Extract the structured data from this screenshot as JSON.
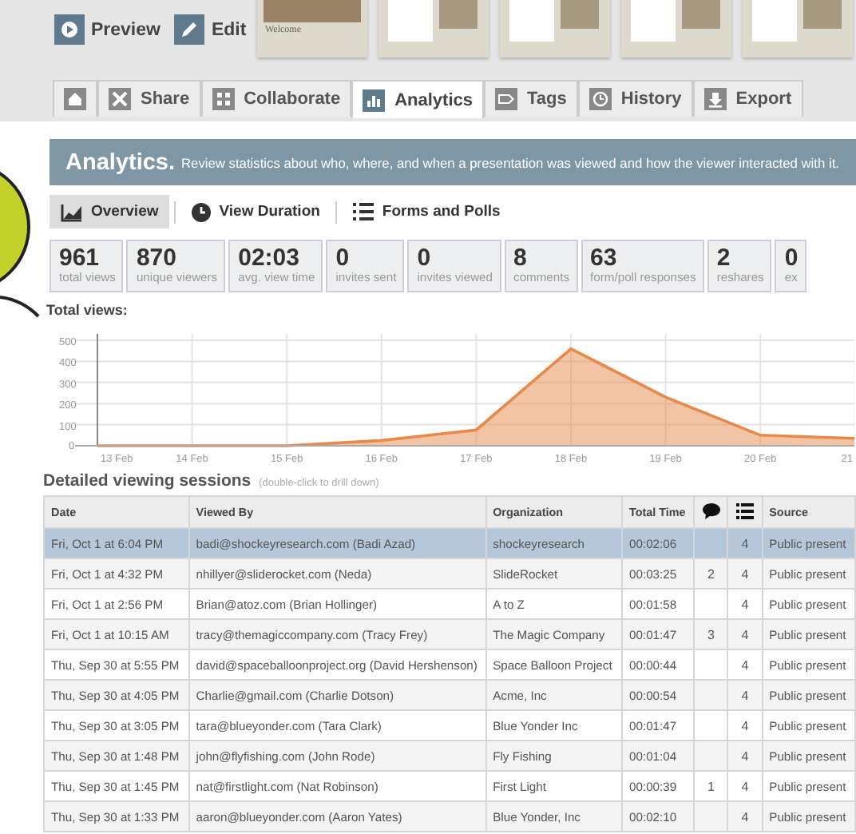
{
  "toolbar": {
    "actions": [
      {
        "kind": "preview",
        "label": "Preview"
      },
      {
        "kind": "edit",
        "label": "Edit"
      }
    ],
    "thumbnails": [
      {
        "kind": "title",
        "caption": "Welcome"
      },
      {
        "kind": "page"
      },
      {
        "kind": "page"
      },
      {
        "kind": "page"
      },
      {
        "kind": "page"
      }
    ]
  },
  "tabs": [
    {
      "kind": "home",
      "selected": false
    },
    {
      "kind": "share",
      "label": "Share",
      "selected": false
    },
    {
      "kind": "collaborate",
      "label": "Collaborate",
      "selected": false
    },
    {
      "kind": "analytics",
      "label": "Analytics",
      "selected": true
    },
    {
      "kind": "tags",
      "label": "Tags",
      "selected": false
    },
    {
      "kind": "history",
      "label": "History",
      "selected": false
    },
    {
      "kind": "export",
      "label": "Export",
      "selected": false
    }
  ],
  "banner": {
    "title": "Analytics.",
    "text": "Review statistics about who, where, and when a presentation was viewed and how the viewer interacted with it."
  },
  "subtabs": [
    {
      "kind": "overview",
      "label": "Overview",
      "selected": true
    },
    {
      "kind": "duration",
      "label": "View Duration",
      "selected": false
    },
    {
      "kind": "forms",
      "label": "Forms and Polls",
      "selected": false
    }
  ],
  "stats": [
    {
      "value": "961",
      "label": "total views"
    },
    {
      "value": "870",
      "label": "unique viewers"
    },
    {
      "value": "02:03",
      "label": "avg. view time"
    },
    {
      "value": "0",
      "label": "invites sent"
    },
    {
      "value": "0",
      "label": "invites viewed"
    },
    {
      "value": "8",
      "label": "comments"
    },
    {
      "value": "63",
      "label": "form/poll responses"
    },
    {
      "value": "2",
      "label": "reshares"
    },
    {
      "value": "0",
      "label": "ex"
    }
  ],
  "total_views": {
    "title": "Total views:",
    "chart_data": {
      "type": "area",
      "categories": [
        "13 Feb",
        "14 Feb",
        "15 Feb",
        "16 Feb",
        "17 Feb",
        "18 Feb",
        "19 Feb",
        "20 Feb",
        "21"
      ],
      "grid": true,
      "series": [
        {
          "color": "#e8894a",
          "values": [
            0,
            0,
            0,
            25,
            75,
            460,
            230,
            50,
            35
          ]
        }
      ],
      "ylim": [
        0,
        500
      ],
      "yticks": [
        0,
        100,
        200,
        300,
        400,
        500
      ]
    }
  },
  "sessions": {
    "title": "Detailed viewing sessions",
    "hint": "(double-click to drill down)",
    "columns": [
      {
        "kind": "text",
        "label": "Date"
      },
      {
        "kind": "text",
        "label": "Viewed By"
      },
      {
        "kind": "text",
        "label": "Organization"
      },
      {
        "kind": "text",
        "label": "Total Time"
      },
      {
        "kind": "comment"
      },
      {
        "kind": "list"
      },
      {
        "kind": "text",
        "label": "Source"
      }
    ],
    "rows": [
      {
        "selected": true,
        "cells": [
          "Fri, Oct 1 at 6:04 PM",
          "badi@shockeyresearch.com (Badi Azad)",
          "shockeyresearch",
          "00:02:06",
          "",
          "4",
          "Public present"
        ]
      },
      {
        "selected": false,
        "cells": [
          "Fri, Oct 1 at 4:32 PM",
          "nhillyer@sliderocket.com (Neda)",
          "SlideRocket",
          "00:03:25",
          "2",
          "4",
          "Public present"
        ]
      },
      {
        "selected": false,
        "cells": [
          "Fri, Oct 1 at 2:56 PM",
          "Brian@atoz.com (Brian Hollinger)",
          "A to Z",
          "00:01:58",
          "",
          "4",
          "Public present"
        ]
      },
      {
        "selected": false,
        "cells": [
          "Fri, Oct 1 at 10:15 AM",
          "tracy@themagiccompany.com (Tracy Frey)",
          "The Magic Company",
          "00:01:47",
          "3",
          "4",
          "Public present"
        ]
      },
      {
        "selected": false,
        "cells": [
          "Thu, Sep 30 at 5:55 PM",
          "david@spaceballoonproject.org (David Hershenson)",
          "Space Balloon Project",
          "00:00:44",
          "",
          "4",
          "Public present"
        ]
      },
      {
        "selected": false,
        "cells": [
          "Thu, Sep 30 at 4:05 PM",
          "Charlie@gmail.com (Charlie Dotson)",
          "Acme, Inc",
          "00:00:54",
          "",
          "4",
          "Public present"
        ]
      },
      {
        "selected": false,
        "cells": [
          "Thu, Sep 30 at 3:05 PM",
          "tara@blueyonder.com (Tara Clark)",
          "Blue Yonder Inc",
          "00:01:47",
          "",
          "4",
          "Public present"
        ]
      },
      {
        "selected": false,
        "cells": [
          "Thu, Sep 30 at 1:48 PM",
          "john@flyfishing.com (John Rode)",
          "Fly Fishing",
          "00:01:04",
          "",
          "4",
          "Public present"
        ]
      },
      {
        "selected": false,
        "cells": [
          "Thu, Sep 30 at 1:45 PM",
          "nat@firstlight.com (Nat Robinson)",
          "First Light",
          "00:00:39",
          "1",
          "4",
          "Public present"
        ]
      },
      {
        "selected": false,
        "cells": [
          "Thu, Sep 30 at 1:33 PM",
          "aaron@blueyonder.com (Aaron Yates)",
          "Blue Yonder, Inc",
          "00:02:10",
          "",
          "4",
          "Public present"
        ]
      }
    ]
  }
}
